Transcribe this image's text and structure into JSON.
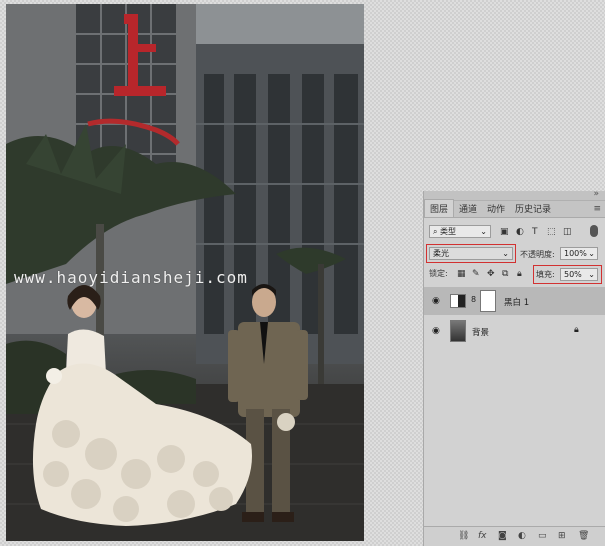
{
  "photo": {
    "watermark": "www.haoyidiansheji.com"
  },
  "layers_panel": {
    "tabs": [
      "图层",
      "通道",
      "动作",
      "历史记录"
    ],
    "active_tab": "图层",
    "filter_kind": "类型",
    "blend_mode": "柔光",
    "opacity_label": "不透明度:",
    "opacity_value": "100%",
    "lock_label": "锁定:",
    "fill_label": "填充:",
    "fill_value": "50%",
    "layers": [
      {
        "name": "黑白 1",
        "selected": true
      },
      {
        "name": "背景",
        "selected": false
      }
    ],
    "bottom_icons": [
      "link-icon",
      "fx-icon",
      "mask-icon",
      "adjustment-icon",
      "folder-icon",
      "new-layer-icon",
      "trash-icon"
    ],
    "highlight_color": "#d23131"
  }
}
